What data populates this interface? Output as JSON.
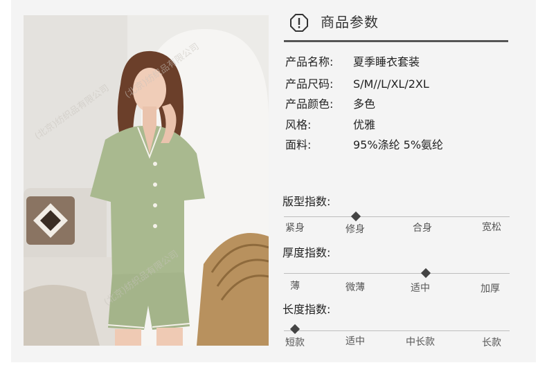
{
  "header": {
    "title": "商品参数",
    "icon": "exclamation-octagon-icon"
  },
  "params": [
    {
      "label": "产品名称:",
      "value": "夏季睡衣套装"
    },
    {
      "label": "产品尺码:",
      "value": "S/M//L/XL/2XL"
    },
    {
      "label": "产品颜色:",
      "value": "多色"
    },
    {
      "label": "风格:",
      "value": "优雅"
    },
    {
      "label": "面料:",
      "value": "95%涤纶 5%氨纶"
    }
  ],
  "scales": [
    {
      "title": "版型指数:",
      "options": [
        "紧身",
        "修身",
        "合身",
        "宽松"
      ],
      "selected_index": 1
    },
    {
      "title": "厚度指数:",
      "options": [
        "薄",
        "微薄",
        "适中",
        "加厚"
      ],
      "selected_index": 2
    },
    {
      "title": "长度指数:",
      "options": [
        "短款",
        "适中",
        "中长款",
        "长款"
      ],
      "selected_index": 0
    }
  ],
  "photo": {
    "watermark": "(北京)纺织品有限公司",
    "garment_color": "#a9b98f",
    "accent": "#444444"
  }
}
